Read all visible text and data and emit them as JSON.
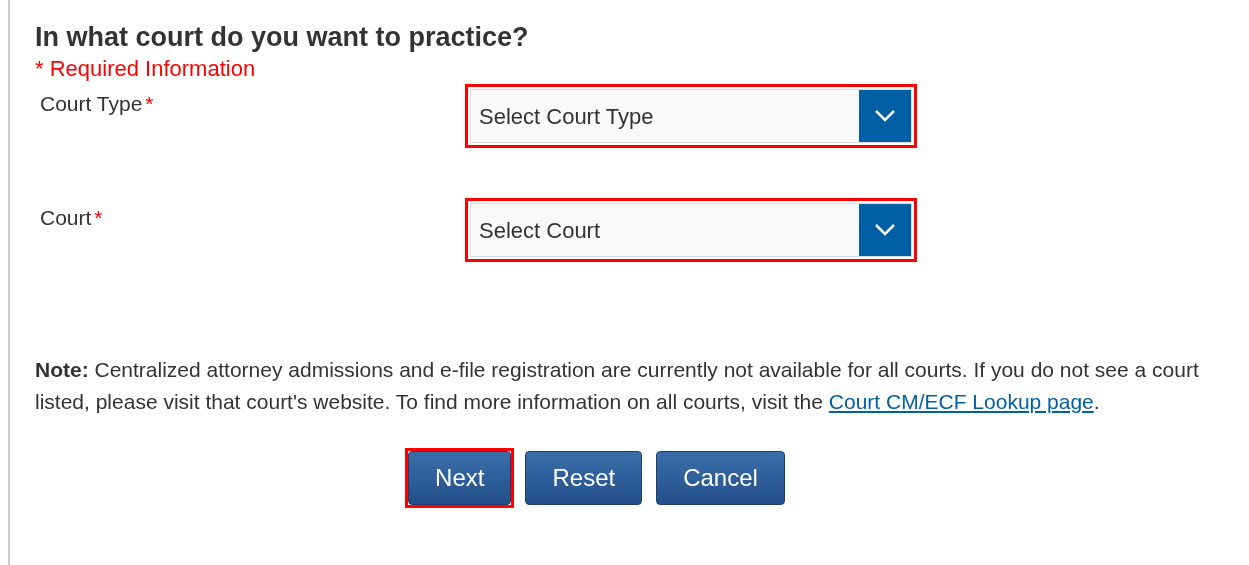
{
  "heading": "In what court do you want to practice?",
  "required_note": "* Required Information",
  "fields": [
    {
      "label": "Court Type",
      "marker": "*",
      "placeholder": "Select Court Type",
      "highlighted": true
    },
    {
      "label": "Court",
      "marker": "*",
      "placeholder": "Select Court",
      "highlighted": true
    }
  ],
  "note": {
    "text": "**Note:** Centralized attorney admissions and e-file registration are currently not available for all courts. If you do not see a court listed, please visit that court's website. To find more information on all courts, visit the ",
    "link": "Court CM/ECF Lookup page",
    "after": "."
  },
  "buttons": [
    {
      "label": "Next",
      "highlighted": true
    },
    {
      "label": "Reset",
      "highlighted": false
    },
    {
      "label": "Cancel",
      "highlighted": false
    }
  ]
}
